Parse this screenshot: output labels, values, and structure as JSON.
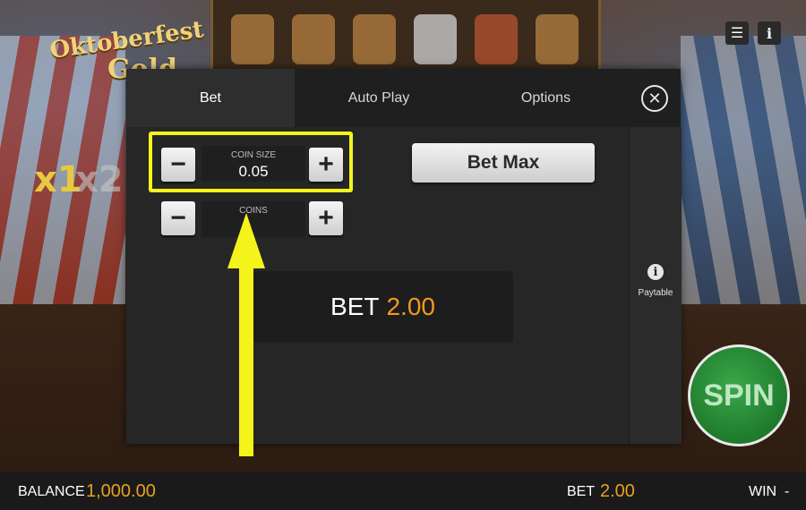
{
  "game": {
    "logo_line1": "Oktoberfest",
    "logo_line2": "Gold",
    "multipliers": [
      "x1",
      "x2"
    ]
  },
  "toolbar": {
    "menu_icon": "menu-icon",
    "info_icon": "info-icon"
  },
  "spin_label": "SPIN",
  "status_bar": {
    "balance_label": "BALANCE",
    "balance_value": "1,000.00",
    "bet_label": "BET",
    "bet_value": "2.00",
    "win_label": "WIN",
    "win_value": "-"
  },
  "modal": {
    "tabs": [
      {
        "label": "Bet",
        "active": true
      },
      {
        "label": "Auto Play",
        "active": false
      },
      {
        "label": "Options",
        "active": false
      }
    ],
    "close_icon": "close-icon",
    "coin_size": {
      "label": "COIN SIZE",
      "value": "0.05",
      "minus": "−",
      "plus": "+"
    },
    "coins": {
      "label": "COINS",
      "value": "",
      "minus": "−",
      "plus": "+"
    },
    "bet_max_label": "Bet Max",
    "bet_label": "BET",
    "bet_value": "2.00",
    "paytable_label": "Paytable",
    "paytable_icon_glyph": "i"
  },
  "colors": {
    "accent": "#f29a1e",
    "highlight": "#f4f41a",
    "modal_bg": "#262626"
  }
}
